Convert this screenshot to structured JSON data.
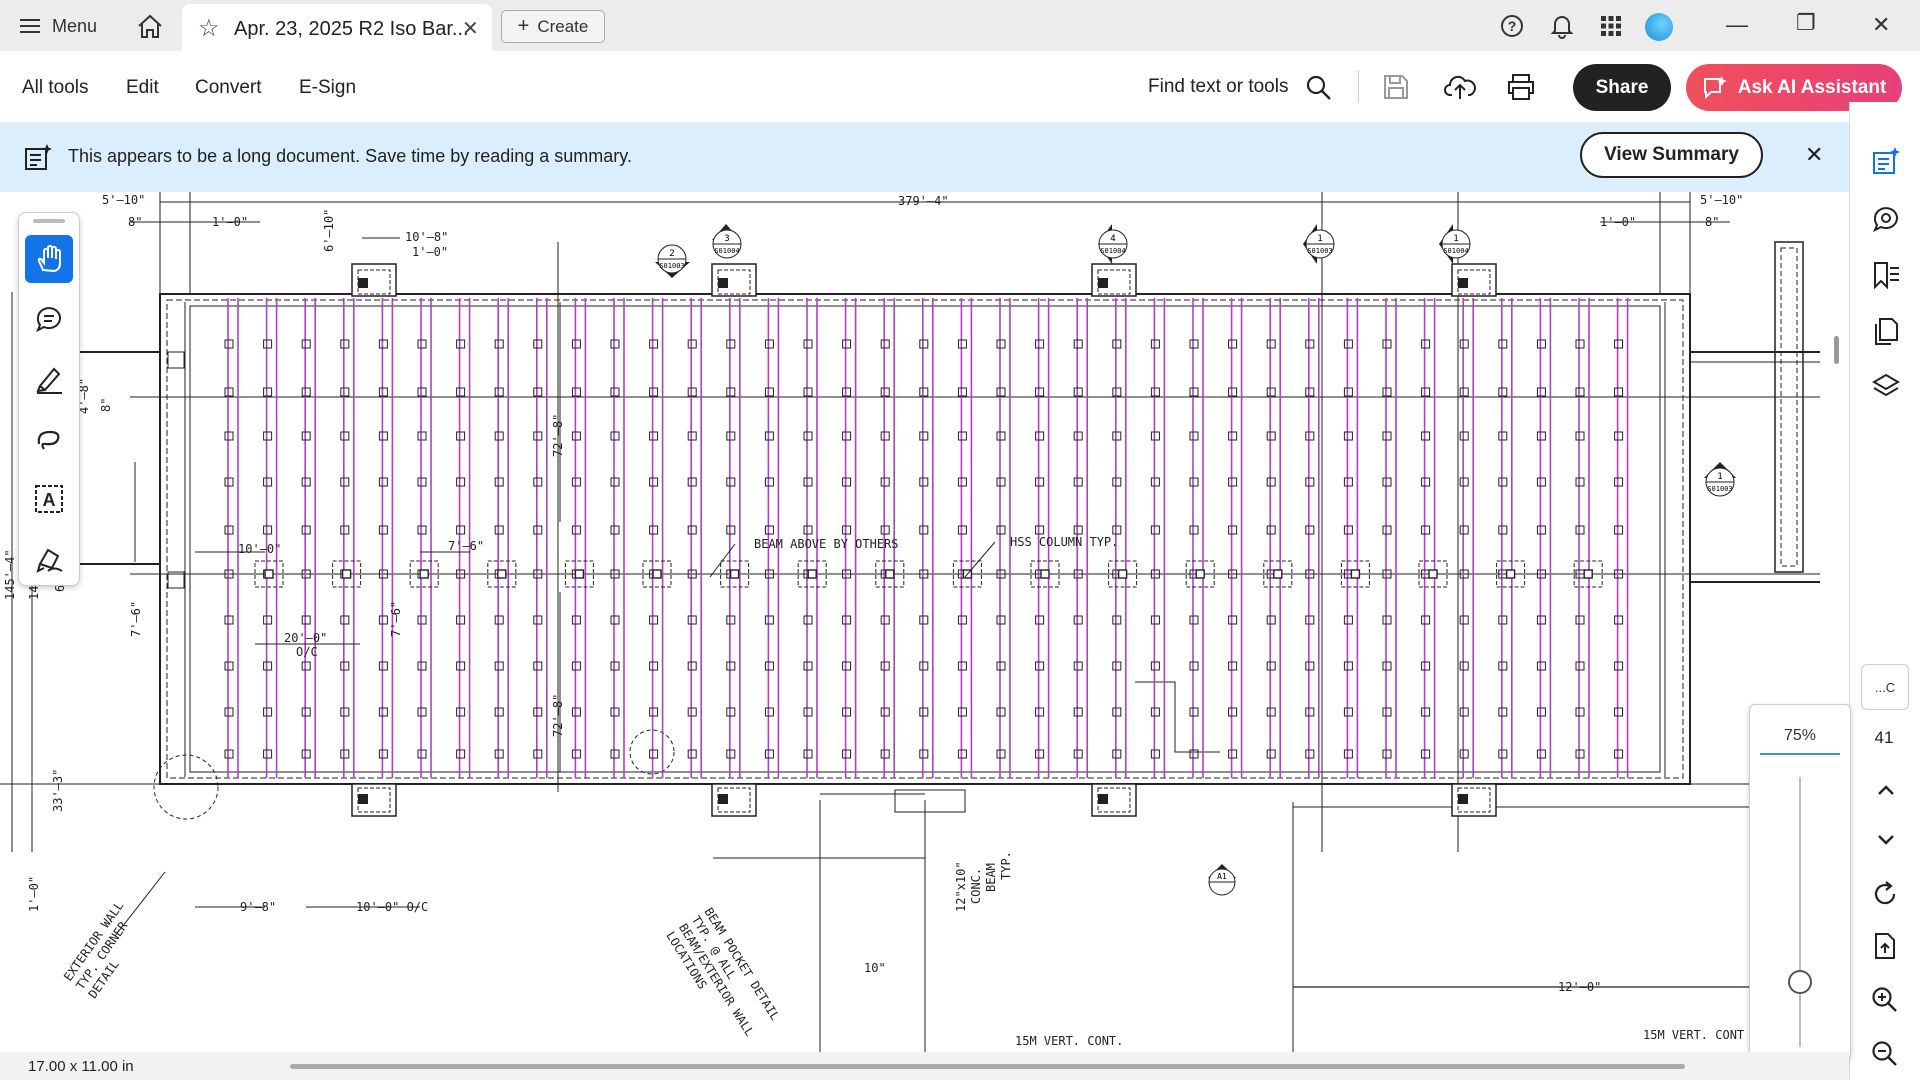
{
  "tabbar": {
    "menu_label": "Menu",
    "tab_title": "Apr. 23, 2025 R2 Iso Bar...",
    "create_label": "Create"
  },
  "toolbar": {
    "menus": [
      "All tools",
      "Edit",
      "Convert",
      "E-Sign"
    ],
    "find_label": "Find text or tools",
    "share_label": "Share",
    "ai_label": "Ask AI Assistant"
  },
  "banner": {
    "message": "This appears to be a long document. Save time by reading a summary.",
    "button_label": "View Summary"
  },
  "right_rail": {
    "page_label": "...C",
    "page_number": "41"
  },
  "zoom": {
    "value": "75%",
    "level": 0.25
  },
  "status": {
    "page_size": "17.00 x 11.00 in"
  },
  "drawing": {
    "dims": {
      "top_left": "5'–10\"",
      "top_left_8": "8\"",
      "top_left_10": "1'–0\"",
      "top_6_10": "6'–10\"",
      "top_10_8": "10'–8\"",
      "top_1_0": "1'–0\"",
      "overall": "379'–4\"",
      "top_right": "5'–10\"",
      "top_right_1": "1'–0\"",
      "top_right_8": "8\"",
      "left_4_8": "4'–8\"",
      "left_8": "8\"",
      "left_145": "145'–4\"",
      "left_14": "14",
      "left_6": "6'",
      "left_7_6": "7'–6\"",
      "left_33": "33'–3\"",
      "left_1_0": "1'–0\"",
      "v_72_8": "72'–8\"",
      "v_72_8b": "72'–8\"",
      "d_10_0": "10'–0\"",
      "d_7_6": "7'–6\"",
      "d_7_6v": "7'–6\"",
      "d_20_0": "20'–0\"",
      "d_oc": "O/C",
      "bottom_9_8": "9'–8\"",
      "bottom_10_0": "10'–0\" O/C",
      "bottom_10": "10\"",
      "bottom_12_0": "12'–0\"",
      "conc_beam": "12\"x10\"",
      "conc_beam2": "CONC.",
      "conc_beam3": "BEAM",
      "conc_beam4": "TYP.",
      "vert_cont": "15M VERT. CONT.",
      "vert_cont2": "15M VERT. CONT"
    },
    "notes": {
      "beam_above": "BEAM ABOVE BY OTHERS",
      "hss": "HSS COLUMN TYP.",
      "ext_wall_1": "EXTERIOR WALL",
      "ext_wall_2": "TYP. CORNER",
      "ext_wall_3": "DETAIL",
      "pocket_1": "BEAM POCKET DETAIL",
      "pocket_2": "TYP. @ ALL",
      "pocket_3": "BEAM/EXTERIOR WALL",
      "pocket_4": "LOCATIONS"
    },
    "section_marks": {
      "m2": "2",
      "m2ref": "S01003",
      "m3": "3",
      "m3ref": "S01004",
      "m4": "4",
      "m4ref": "S01004",
      "m1a": "1",
      "m1aref": "S01003",
      "m1b": "1",
      "m1bref": "S01004",
      "m1c": "1",
      "m1cref": "S01003",
      "a1": "A1"
    }
  },
  "colors": {
    "accent": "#1473e6",
    "rebar": "#b040c8",
    "ai_gradient_start": "#f0505a"
  }
}
